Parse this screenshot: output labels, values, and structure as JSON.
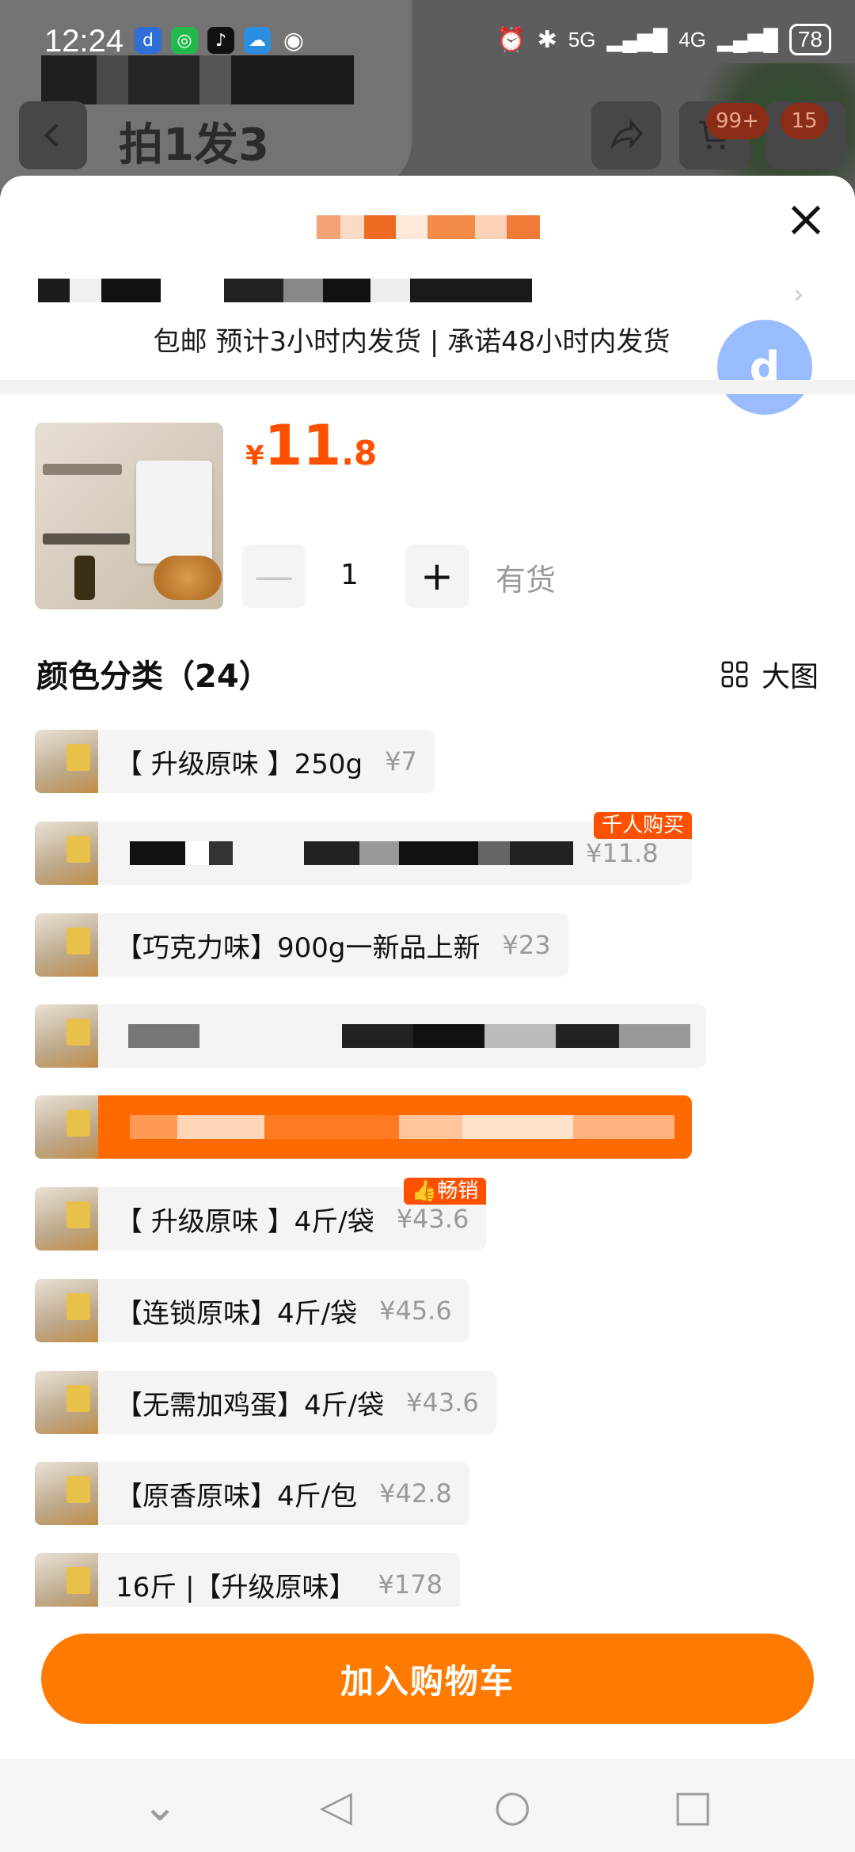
{
  "status_bar": {
    "time": "12:24",
    "network_5g": "5G",
    "network_4g": "4G",
    "battery": "78"
  },
  "background_page": {
    "title": "拍1发3",
    "cart_badge": "99+",
    "more_badge": "15"
  },
  "sheet": {
    "shipping_info": "包邮 预计3小时内发货 | 承诺48小时内发货",
    "price": {
      "currency": "¥",
      "integer": "11",
      "decimal": ".8"
    },
    "quantity": "1",
    "stock_status": "有货",
    "section_title": "颜色分类（24）",
    "big_view_label": "大图",
    "options": [
      {
        "label": "【 升级原味 】250g",
        "price": "¥7",
        "tag": ""
      },
      {
        "label": "",
        "price": "¥11.8",
        "tag": "千人购买"
      },
      {
        "label": "【巧克力味】900g一新品上新",
        "price": "¥23",
        "tag": ""
      },
      {
        "label": "",
        "price": "",
        "tag": ""
      },
      {
        "label": "",
        "price": "",
        "tag": "",
        "selected": true
      },
      {
        "label": "【 升级原味 】4斤/袋",
        "price": "¥43.6",
        "tag": "畅销"
      },
      {
        "label": "【连锁原味】4斤/袋",
        "price": "¥45.6",
        "tag": ""
      },
      {
        "label": "【无需加鸡蛋】4斤/袋",
        "price": "¥43.6",
        "tag": ""
      },
      {
        "label": "【原香原味】4斤/包",
        "price": "¥42.8",
        "tag": ""
      },
      {
        "label": "16斤 |【升级原味】",
        "price": "¥178",
        "tag": ""
      }
    ],
    "add_to_cart": "加入购物车"
  },
  "colors": {
    "accent": "#ff5000",
    "button": "#ff7a00"
  }
}
